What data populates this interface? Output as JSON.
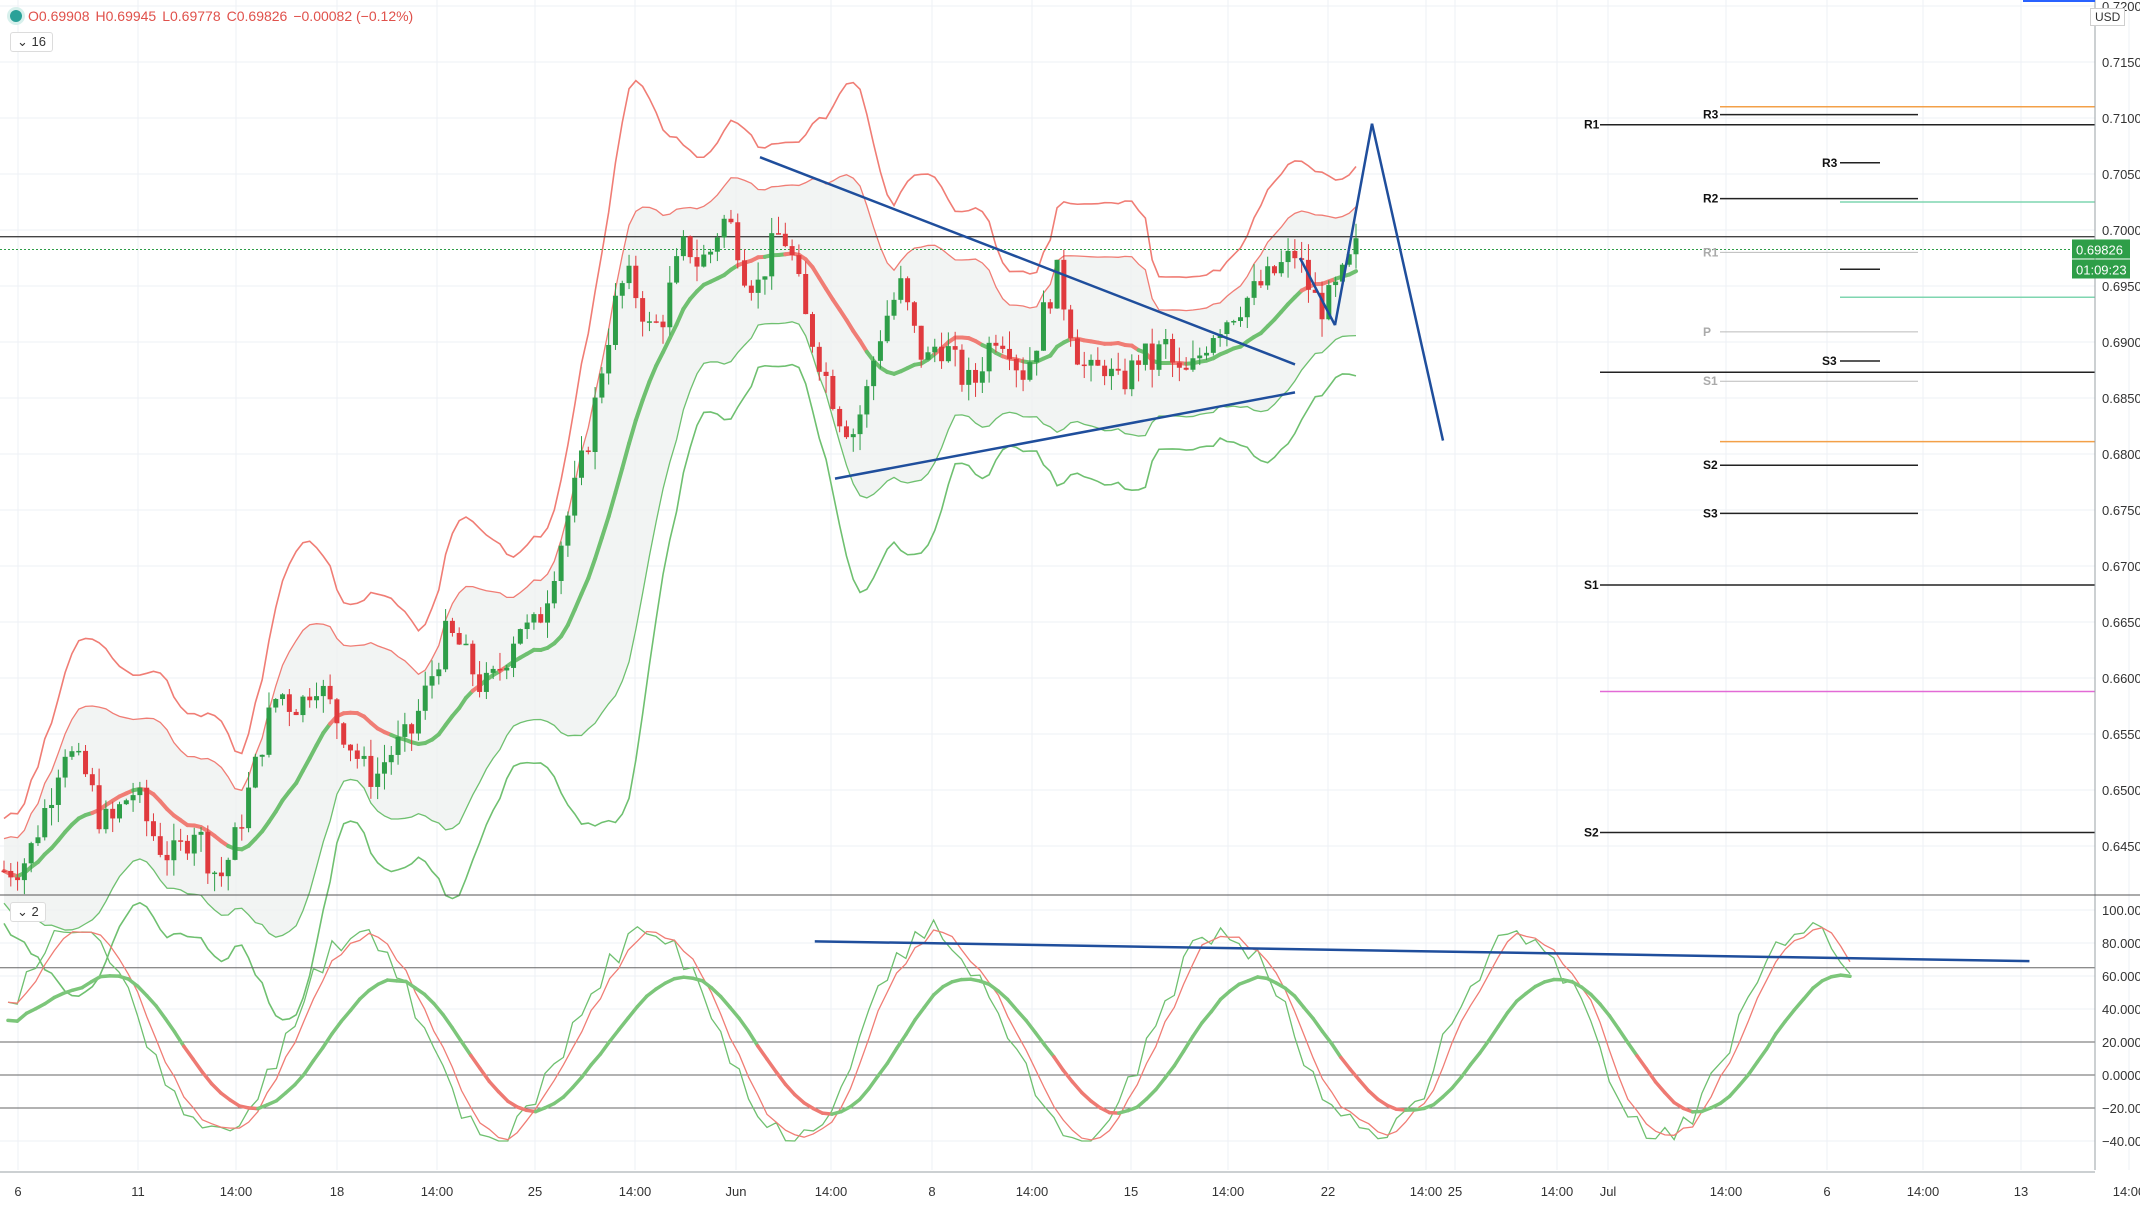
{
  "header": {
    "o": "O0.69908",
    "h": "H0.69945",
    "l": "L0.69778",
    "c": "C0.69826",
    "chg": "−0.00082 (−0.12%)",
    "interval_chip": "16",
    "indicator_chip": "2",
    "currency": "USD"
  },
  "price_axis": [
    "0.72000",
    "0.71500",
    "0.71000",
    "0.70500",
    "0.70000",
    "0.69500",
    "0.69000",
    "0.68500",
    "0.68000",
    "0.67500",
    "0.67000",
    "0.66500",
    "0.66000",
    "0.65500",
    "0.65000",
    "0.64500"
  ],
  "osc_axis": [
    "100.00000",
    "80.00000",
    "60.00000",
    "40.00000",
    "20.00000",
    "0.00000",
    "−20.00000",
    "−40.00000"
  ],
  "last_price": "0.69826",
  "countdown": "01:09:23",
  "time_axis": [
    "6",
    "11",
    "14:00",
    "18",
    "14:00",
    "25",
    "14:00",
    "Jun",
    "14:00",
    "8",
    "14:00",
    "15",
    "14:00",
    "22",
    "14:00",
    "25",
    "14:00",
    "Jul",
    "14:00",
    "6",
    "14:00",
    "13",
    "14:00"
  ],
  "pivots_weekly": {
    "R1": "R1",
    "S1": "S1",
    "S2": "S2"
  },
  "pivots_daily": {
    "R3": "R3",
    "R2": "R2",
    "R1": "R1",
    "P": "P",
    "S1": "S1",
    "S2": "S2",
    "S3": "S3"
  },
  "pivots_h4": {
    "R3": "R3",
    "S3": "S3"
  },
  "colors": {
    "up": "#2e9e48",
    "down": "#e03a3e",
    "band_red": "#f07d75",
    "band_green": "#6fc070",
    "trend": "#1f4e9c",
    "orange": "#f3a048",
    "magenta": "#e26ad6",
    "teal": "#7fd6b0"
  },
  "chart_data": {
    "type": "candlestick",
    "symbol_ohlc": {
      "open": 0.69908,
      "high": 0.69945,
      "low": 0.69778,
      "close": 0.69826
    },
    "ylim": [
      0.642,
      0.721
    ],
    "oscillator_ylim": [
      -45,
      103
    ],
    "oscillator_levels": [
      80,
      20,
      0,
      -20
    ],
    "weekly_pivots": {
      "R1": 0.7094,
      "S1": 0.6683,
      "S2": 0.6462
    },
    "daily_pivots": {
      "R3": 0.7103,
      "R2": 0.7028,
      "P": 0.6909,
      "S1": 0.6865,
      "S2": 0.679,
      "S3": 0.6747
    },
    "extra_levels": {
      "orange_top": 0.711,
      "orange_bottom": 0.6811,
      "magenta": 0.6588,
      "teal_upper": 0.7025,
      "teal_lower": 0.694,
      "black_mid": 0.6873
    },
    "candles_close_path": [
      0.6428,
      0.643,
      0.644,
      0.647,
      0.65,
      0.654,
      0.6525,
      0.651,
      0.6475,
      0.647,
      0.649,
      0.65,
      0.647,
      0.645,
      0.644,
      0.645,
      0.647,
      0.644,
      0.642,
      0.6445,
      0.648,
      0.652,
      0.656,
      0.659,
      0.6575,
      0.658,
      0.66,
      0.658,
      0.656,
      0.654,
      0.652,
      0.651,
      0.653,
      0.654,
      0.655,
      0.658,
      0.661,
      0.664,
      0.663,
      0.661,
      0.659,
      0.66,
      0.662,
      0.665,
      0.664,
      0.666,
      0.67,
      0.674,
      0.678,
      0.682,
      0.688,
      0.693,
      0.696,
      0.694,
      0.691,
      0.692,
      0.696,
      0.699,
      0.697,
      0.698,
      0.701,
      0.7,
      0.696,
      0.695,
      0.698,
      0.7,
      0.697,
      0.692,
      0.689,
      0.686,
      0.683,
      0.682,
      0.685,
      0.69,
      0.693,
      0.695,
      0.691,
      0.688,
      0.69,
      0.689,
      0.687,
      0.686,
      0.689,
      0.691,
      0.69,
      0.687,
      0.689,
      0.693,
      0.696,
      0.692,
      0.688,
      0.687,
      0.688,
      0.686,
      0.687,
      0.689,
      0.688,
      0.69,
      0.687,
      0.687,
      0.689,
      0.691,
      0.692,
      0.693,
      0.694,
      0.695,
      0.696,
      0.697,
      0.698,
      0.695,
      0.693,
      0.694,
      0.696,
      0.6983
    ],
    "trendlines": [
      {
        "from": [
          760,
          0.7065
        ],
        "to": [
          1295,
          0.688
        ]
      },
      {
        "from": [
          835,
          0.6778
        ],
        "to": [
          1295,
          0.6855
        ]
      },
      {
        "from": [
          1300,
          0.6975
        ],
        "to": [
          1335,
          0.6915
        ]
      },
      {
        "from": [
          1335,
          0.6915
        ],
        "to": [
          1372,
          0.7095
        ]
      },
      {
        "from": [
          1372,
          0.7095
        ],
        "to": [
          1443,
          0.6812
        ]
      }
    ],
    "oscillator_trendline": {
      "from": [
        597,
        81
      ],
      "to": [
        1487,
        69
      ]
    }
  }
}
